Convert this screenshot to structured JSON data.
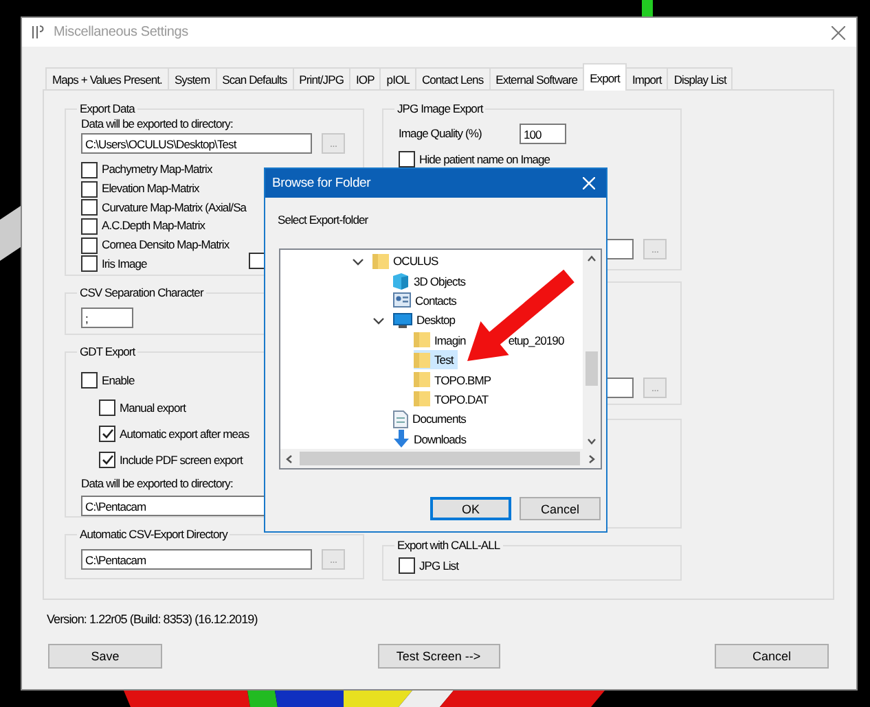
{
  "window": {
    "title": "Miscellaneous Settings"
  },
  "tabs": [
    {
      "label": "Maps + Values Present.",
      "selected": false
    },
    {
      "label": "System",
      "selected": false
    },
    {
      "label": "Scan Defaults",
      "selected": false
    },
    {
      "label": "Print/JPG",
      "selected": false
    },
    {
      "label": "IOP",
      "selected": false
    },
    {
      "label": "pIOL",
      "selected": false
    },
    {
      "label": "Contact Lens",
      "selected": false
    },
    {
      "label": "External Software",
      "selected": false
    },
    {
      "label": "Export",
      "selected": true
    },
    {
      "label": "Import",
      "selected": false
    },
    {
      "label": "Display List",
      "selected": false
    }
  ],
  "export_data": {
    "title": "Export Data",
    "directory_label": "Data will be exported to directory:",
    "directory": "C:\\Users\\OCULUS\\Desktop\\Test",
    "browse": "...",
    "options": [
      {
        "label": "Pachymetry Map-Matrix",
        "checked": false
      },
      {
        "label": "Elevation Map-Matrix",
        "checked": false
      },
      {
        "label": "Curvature Map-Matrix (Axial/Sa",
        "checked": false
      },
      {
        "label": "A.C.Depth Map-Matrix",
        "checked": false
      },
      {
        "label": "Cornea Densito Map-Matrix",
        "checked": false
      },
      {
        "label": "Iris Image",
        "checked": false
      }
    ],
    "extra_option": {
      "checked": false
    }
  },
  "csv_separation": {
    "title": "CSV Separation Character",
    "value": ";"
  },
  "gdt_export": {
    "title": "GDT Export",
    "enable": {
      "label": "Enable",
      "checked": false
    },
    "options": [
      {
        "label": "Manual export",
        "checked": false
      },
      {
        "label": "Automatic export after meas",
        "checked": true
      },
      {
        "label": "Include PDF screen export",
        "checked": true
      }
    ],
    "directory_label": "Data will be exported to directory:",
    "directory": "C:\\Pentacam"
  },
  "csv_export_directory": {
    "title": "Automatic CSV-Export Directory",
    "directory": "C:\\Pentacam",
    "browse": "..."
  },
  "jpg_export": {
    "title": "JPG Image Export",
    "quality_label": "Image Quality (%)",
    "quality": "100",
    "hide_name": {
      "label": "Hide patient name on Image",
      "checked": false
    },
    "browse": "..."
  },
  "group_2": {
    "browse": "..."
  },
  "call_all": {
    "title": "Export with CALL-ALL",
    "jpg_list": {
      "label": "JPG List",
      "checked": false
    }
  },
  "version": "Version: 1.22r05  (Build: 8353) (16.12.2019)",
  "buttons": [
    "Save",
    "Test Screen -->",
    "Cancel"
  ],
  "dialog": {
    "title": "Browse for Folder",
    "prompt": "Select Export-folder",
    "tree": [
      {
        "label": "OCULUS",
        "kind": "folder",
        "selected": false,
        "expanded": true,
        "children": [
          {
            "label": "3D Objects",
            "kind": "objects",
            "selected": false
          },
          {
            "label": "Contacts",
            "kind": "contacts",
            "selected": false
          },
          {
            "label": "Desktop",
            "kind": "desktop",
            "selected": false,
            "expanded": true,
            "children": [
              {
                "label": "Imagin",
                "label_2": "etup_20190",
                "kind": "folder",
                "selected": false
              },
              {
                "label": "Test",
                "kind": "folder",
                "selected": true
              },
              {
                "label": "TOPO.BMP",
                "kind": "folder",
                "selected": false
              },
              {
                "label": "TOPO.DAT",
                "kind": "folder",
                "selected": false
              }
            ]
          },
          {
            "label": "Documents",
            "kind": "documents",
            "selected": false
          },
          {
            "label": "Downloads",
            "kind": "downloads",
            "selected": false
          }
        ]
      }
    ],
    "buttons": [
      {
        "label": "OK",
        "default": true
      },
      {
        "label": "Cancel",
        "default": false
      }
    ]
  }
}
